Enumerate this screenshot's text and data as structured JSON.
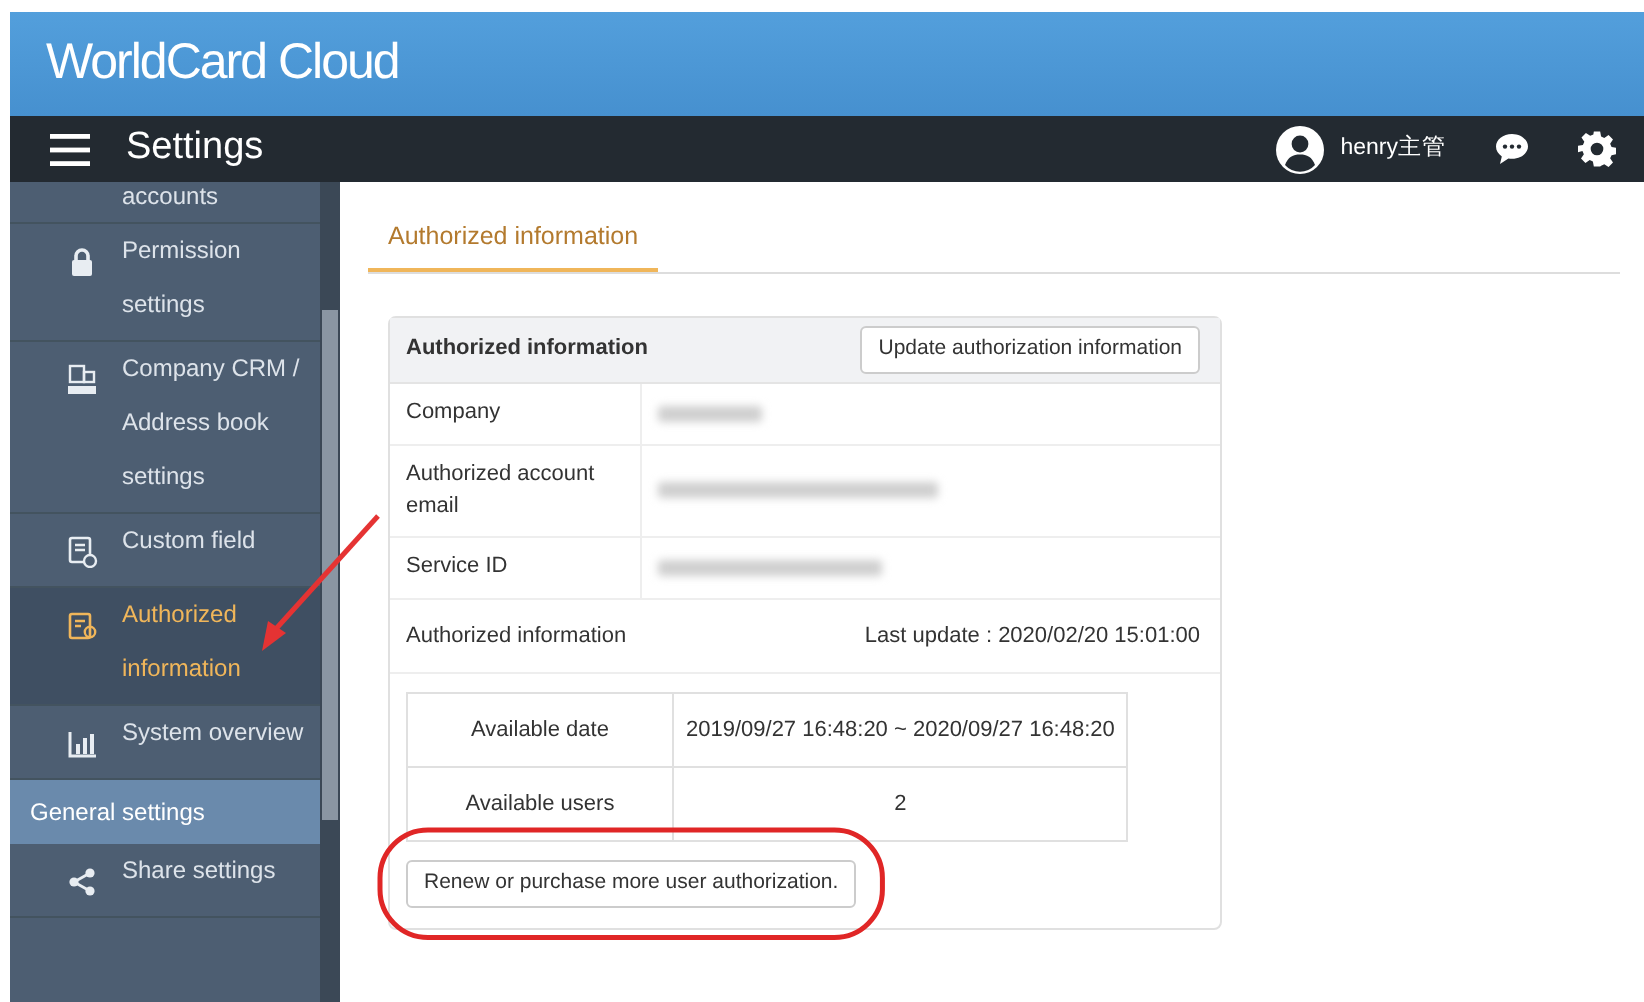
{
  "app": {
    "title": "WorldCard Cloud"
  },
  "navbar": {
    "title": "Settings",
    "user": "henry主管"
  },
  "sidebar": {
    "items": [
      {
        "kind": "item",
        "label": "accounts",
        "selected": false
      },
      {
        "kind": "item",
        "label": "Permission settings",
        "selected": false
      },
      {
        "kind": "item",
        "label": "Company CRM / Address book settings",
        "selected": false
      },
      {
        "kind": "item",
        "label": "Custom field",
        "selected": false
      },
      {
        "kind": "item",
        "label": "Authorized information",
        "selected": true
      },
      {
        "kind": "item",
        "label": "System overview",
        "selected": false
      },
      {
        "kind": "section",
        "label": "General settings",
        "selected": false
      },
      {
        "kind": "item",
        "label": "Share settings",
        "selected": false
      }
    ]
  },
  "tabs": [
    {
      "label": "Authorized information",
      "selected": true
    }
  ],
  "card": {
    "title": "Authorized information",
    "update_button": "Update authorization information",
    "fields": [
      {
        "label": "Company",
        "redacted": true
      },
      {
        "label": "Authorized account email",
        "redacted": true
      },
      {
        "label": "Service ID",
        "redacted": true
      }
    ],
    "section_title": "Authorized information",
    "last_update": "Last update : 2020/02/20 15:01:00",
    "details": [
      {
        "label": "Available date",
        "value": "2019/09/27 16:48:20 ~ 2020/09/27 16:48:20"
      },
      {
        "label": "Available users",
        "value": "2"
      }
    ],
    "renew_button": "Renew or purchase more user authorization."
  },
  "annotations": {
    "arrow": true,
    "ellipse": true
  }
}
